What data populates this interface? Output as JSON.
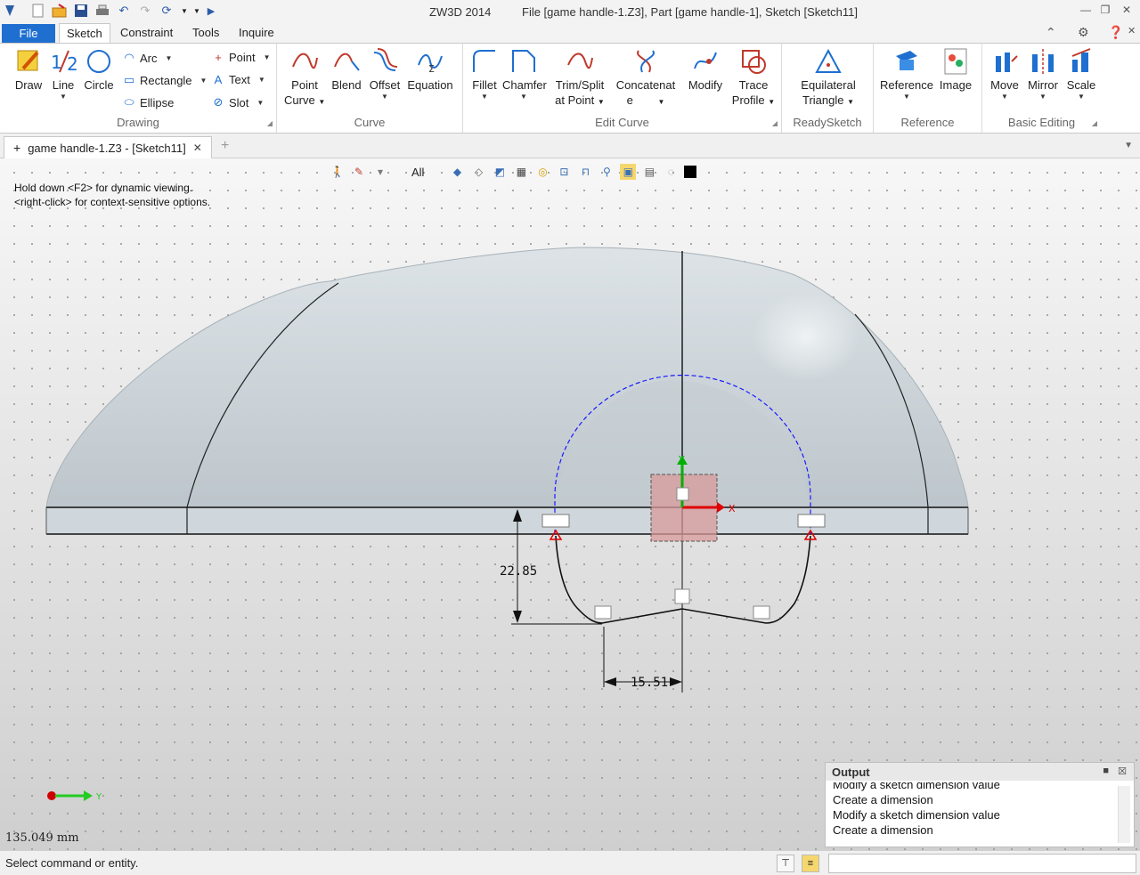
{
  "titlebar": {
    "app_title": "ZW3D 2014",
    "doc_title": "File [game handle-1.Z3],  Part [game handle-1],  Sketch [Sketch11]"
  },
  "ribbon_tabs": [
    {
      "label": "File"
    },
    {
      "label": "Sketch"
    },
    {
      "label": "Constraint"
    },
    {
      "label": "Tools"
    },
    {
      "label": "Inquire"
    }
  ],
  "ribbon": {
    "drawing": {
      "label": "Drawing",
      "draw": "Draw",
      "line": "Line",
      "circle": "Circle",
      "arc": "Arc",
      "rectangle": "Rectangle",
      "ellipse": "Ellipse",
      "point": "Point",
      "text": "Text",
      "slot": "Slot"
    },
    "curve": {
      "label": "Curve",
      "point_curve": [
        "Point",
        "Curve"
      ],
      "blend": "Blend",
      "offset": "Offset",
      "equation": "Equation"
    },
    "edit_curve": {
      "label": "Edit Curve",
      "fillet": "Fillet",
      "chamfer": "Chamfer",
      "trim_split": [
        "Trim/Split",
        "at Point"
      ],
      "concatenate": [
        "Concatenat",
        "e"
      ],
      "modify": "Modify",
      "trace_profile": [
        "Trace",
        "Profile"
      ]
    },
    "ready_sketch": {
      "label": "ReadySketch",
      "equilateral_triangle": [
        "Equilateral",
        "Triangle"
      ]
    },
    "reference": {
      "label": "Reference",
      "reference": "Reference",
      "image": "Image"
    },
    "basic_editing": {
      "label": "Basic Editing",
      "move": "Move",
      "mirror": "Mirror",
      "scale": "Scale"
    }
  },
  "doc_tab": {
    "label": "game handle-1.Z3 - [Sketch11]"
  },
  "viewport": {
    "filter": "All",
    "hint_line1": "Hold down <F2> for dynamic viewing.",
    "hint_line2": "<right-click> for context-sensitive options.",
    "dim_vertical": "22.85",
    "dim_horizontal": "15.51",
    "axis_x": "X",
    "axis_y": "Y",
    "measure": "135.049 mm"
  },
  "output": {
    "title": "Output",
    "lines": [
      "Modify a sketch dimension value",
      "Create a dimension",
      "Modify a sketch dimension value",
      "Create a dimension"
    ]
  },
  "status": {
    "text": "Select command or entity."
  },
  "colors": {
    "accent": "#1e6fd0",
    "sketch_line": "#111111",
    "construction_arc": "#1a1aff",
    "x_axis": "#e00000",
    "y_axis": "#00b000"
  }
}
